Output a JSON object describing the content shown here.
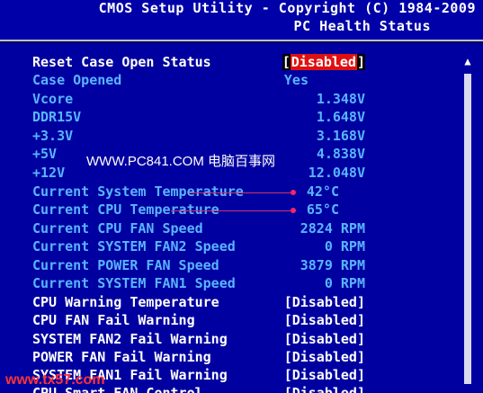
{
  "header": {
    "line1": "CMOS Setup Utility - Copyright (C) 1984-2009",
    "line2": "PC Health Status"
  },
  "colors": {
    "background": "#0000a0",
    "header_bg": "#0000a8",
    "label_white": "#ffffff",
    "label_blue": "#5ab4ff",
    "highlight_red": "#e01010"
  },
  "rows": [
    {
      "label": "Reset Case Open Status",
      "value_prefix": "[",
      "value_highlight": "Disabled",
      "value_suffix": "]",
      "style": "white"
    },
    {
      "label": "Case Opened",
      "value": "Yes",
      "style": "blue"
    },
    {
      "label": "Vcore",
      "value": "1.348V",
      "style": "blue"
    },
    {
      "label": "DDR15V",
      "value": "1.648V",
      "style": "blue"
    },
    {
      "label": "+3.3V",
      "value": "3.168V",
      "style": "blue"
    },
    {
      "label": "+5V",
      "value": "4.838V",
      "style": "blue"
    },
    {
      "label": "+12V",
      "value": "12.048V",
      "style": "blue"
    },
    {
      "label": "Current System Temperature",
      "value": "42°C",
      "style": "blue"
    },
    {
      "label": "Current CPU Temperature",
      "value": "65°C",
      "style": "blue"
    },
    {
      "label": "Current CPU FAN Speed",
      "value": "2824 RPM",
      "style": "blue"
    },
    {
      "label": "Current SYSTEM FAN2 Speed",
      "value": "0 RPM",
      "style": "blue"
    },
    {
      "label": "Current POWER FAN Speed",
      "value": "3879 RPM",
      "style": "blue"
    },
    {
      "label": "Current SYSTEM FAN1 Speed",
      "value": "0 RPM",
      "style": "blue"
    },
    {
      "label": "CPU Warning Temperature",
      "value": "[Disabled]",
      "style": "white"
    },
    {
      "label": "CPU FAN Fail Warning",
      "value": "[Disabled]",
      "style": "white"
    },
    {
      "label": "SYSTEM FAN2 Fail Warning",
      "value": "[Disabled]",
      "style": "white"
    },
    {
      "label": "POWER FAN Fail Warning",
      "value": "[Disabled]",
      "style": "white"
    },
    {
      "label": "SYSTEM FAN1 Fail Warning",
      "value": "[Disabled]",
      "style": "white"
    },
    {
      "label": "CPU Smart FAN Control",
      "value": "[Disabled]",
      "style": "white"
    }
  ],
  "scrollbar": {
    "up_icon": "triangle-up-icon"
  },
  "watermark": {
    "text": "WWW.PC841.COM 电脑百事网",
    "footer": "www.tx57.com"
  }
}
